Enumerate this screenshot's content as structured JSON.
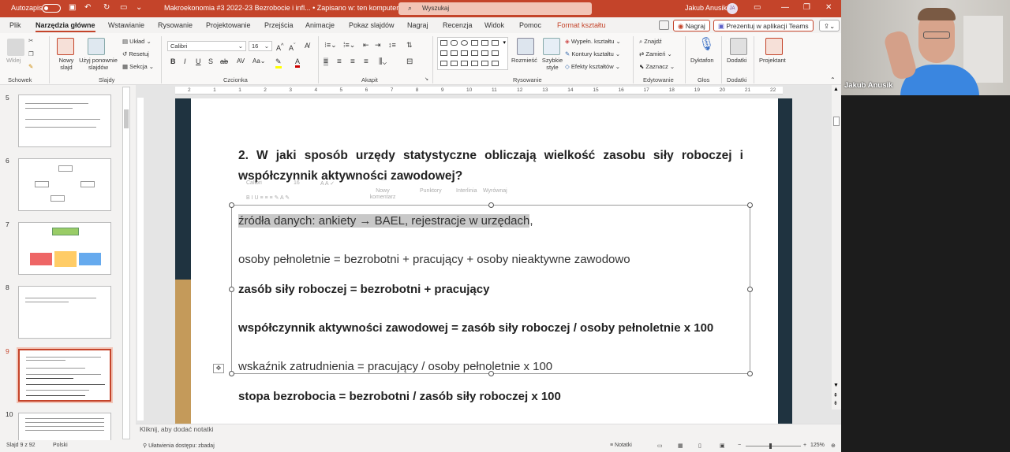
{
  "titlebar": {
    "autosave_label": "Autozapis",
    "doc_title": "Makroekonomia #3 2022-23 Bezrobocie i infl... • Zapisano w: ten komputer",
    "search_placeholder": "Wyszukaj",
    "user_name": "Jakub Anusik",
    "user_initials": "JA"
  },
  "menu": {
    "tabs": [
      "Plik",
      "Narzędzia główne",
      "Wstawianie",
      "Rysowanie",
      "Projektowanie",
      "Przejścia",
      "Animacje",
      "Pokaz slajdów",
      "Nagraj",
      "Recenzja",
      "Widok",
      "Pomoc",
      "Format kształtu"
    ],
    "active_index": 1,
    "record_label": "Nagraj",
    "present_teams_label": "Prezentuj w aplikacji Teams"
  },
  "ribbon": {
    "clipboard": {
      "paste_label": "Wklej",
      "group": "Schowek"
    },
    "slides": {
      "new_slide": "Nowy slajd",
      "reuse": "Użyj ponownie slajdów",
      "layout": "Układ",
      "reset": "Resetuj",
      "section": "Sekcja",
      "group": "Slajdy"
    },
    "font": {
      "family": "Calibri",
      "size": "16",
      "group": "Czcionka"
    },
    "paragraph": {
      "group": "Akapit"
    },
    "drawing": {
      "arrange": "Rozmieść",
      "quick_styles": "Szybkie style",
      "fill": "Wypełn. kształtu",
      "outline": "Kontury kształtu",
      "effects": "Efekty kształtów",
      "group": "Rysowanie"
    },
    "editing": {
      "find": "Znajdź",
      "replace": "Zamień",
      "select": "Zaznacz",
      "group": "Edytowanie"
    },
    "voice": {
      "dictate": "Dyktafon",
      "group": "Głos"
    },
    "addins": {
      "label": "Dodatki",
      "group": "Dodatki"
    },
    "designer": {
      "label": "Projektant"
    }
  },
  "thumbs": {
    "numbers": [
      "5",
      "6",
      "7",
      "8",
      "9",
      "10"
    ],
    "selected": "9"
  },
  "ruler": {
    "ticks": [
      "2",
      "1",
      "1",
      "2",
      "3",
      "4",
      "5",
      "6",
      "7",
      "8",
      "9",
      "10",
      "11",
      "12",
      "13",
      "14",
      "15",
      "16",
      "17",
      "18",
      "19",
      "20",
      "21",
      "22"
    ]
  },
  "slide": {
    "question": "2. W jaki sposób urzędy statystyczne obliczają wielkość zasobu siły roboczej i współczynnik aktywności zawodowej?",
    "line1_highlight": "źródła danych: ankiety → BAEL, rejestracje w urzędach",
    "line1_tail": ",",
    "line2": "osoby pełnoletnie = bezrobotni + pracujący + osoby nieaktywne zawodowo",
    "line3": "zasób siły roboczej = bezrobotni + pracujący",
    "line4": "współczynnik aktywności zawodowej = zasób siły roboczej / osoby pełnoletnie x 100",
    "line5": "wskaźnik zatrudnienia = pracujący / osoby pełnoletnie x 100",
    "line6": "stopa bezrobocia = bezrobotni / zasób siły roboczej x 100",
    "minitoolbar": {
      "font": "Calibri",
      "size": "16",
      "comment": "Nowy komentarz",
      "bullets": "Punktory",
      "spacing": "Interlinia",
      "styles": "Wyrównaj"
    }
  },
  "notes_placeholder": "Kliknij, aby dodać notatki",
  "status": {
    "slide_pos": "Slajd 9 z 92",
    "language": "Polski",
    "accessibility": "Ułatwienia dostępu: zbadaj",
    "notes": "Notatki",
    "zoom": "125%"
  },
  "video": {
    "name": "Jakub Anusik"
  },
  "colors": {
    "accent": "#c4442a",
    "slide_dark": "#1f3340",
    "slide_gold": "#c49a5a"
  }
}
